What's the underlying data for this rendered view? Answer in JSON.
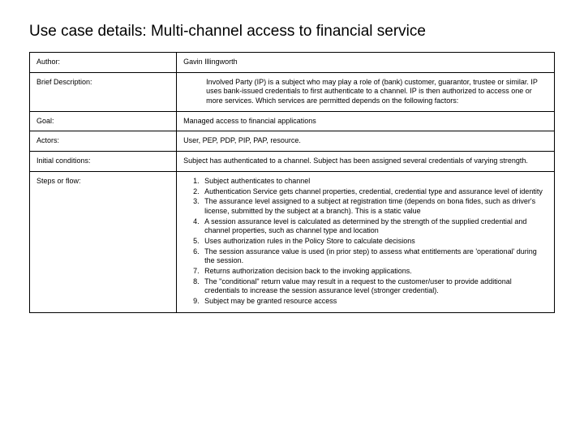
{
  "title": "Use case details: Multi-channel access to financial service",
  "rows": {
    "author": {
      "label": "Author:",
      "value": "Gavin Illingworth"
    },
    "brief": {
      "label": "Brief Description:",
      "value": "Involved Party (IP) is a subject who may play a role of (bank) customer, guarantor, trustee or similar. IP uses bank-issued credentials to first authenticate to a channel. IP is then authorized to access one or more services. Which services are permitted depends on the following factors:"
    },
    "goal": {
      "label": "Goal:",
      "value": "Managed access to  financial applications"
    },
    "actors": {
      "label": "Actors:",
      "value": "User, PEP, PDP, PIP, PAP, resource."
    },
    "initial": {
      "label": "Initial conditions:",
      "value": "Subject has authenticated to a channel. Subject has been assigned several credentials of varying strength."
    },
    "steps": {
      "label": "Steps or flow:",
      "items": [
        "Subject authenticates to channel",
        "Authentication Service gets channel properties, credential, credential type and assurance level of identity",
        "The assurance level assigned to a subject at registration time (depends on bona fides, such as driver's license, submitted by the subject at a branch). This is a static value",
        "A session assurance level is calculated as determined by the strength of the supplied credential and channel properties, such as channel type and location",
        "Uses authorization rules in the Policy Store to calculate decisions",
        "The session assurance value is used (in prior step)  to assess what entitlements are 'operational' during the session.",
        "Returns authorization decision back to the invoking applications.",
        "The \"conditional\" return value may result in a request to the customer/user to provide additional credentials to increase the session assurance level (stronger credential).",
        "Subject may be granted resource access"
      ]
    }
  }
}
